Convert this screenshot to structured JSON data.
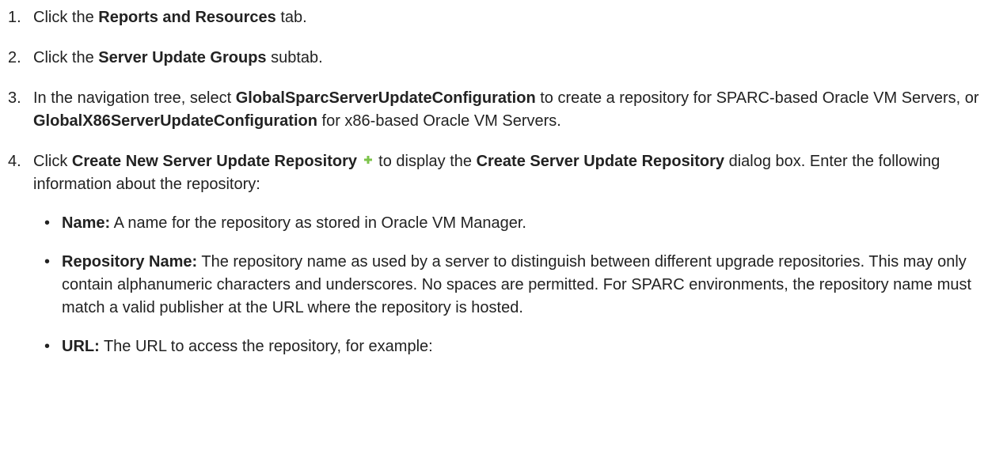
{
  "steps": [
    {
      "num": "1.",
      "t1": "Click the ",
      "b1": "Reports and Resources",
      "t2": " tab."
    },
    {
      "num": "2.",
      "t1": "Click the ",
      "b1": "Server Update Groups",
      "t2": " subtab."
    },
    {
      "num": "3.",
      "t1": "In the navigation tree, select ",
      "b1": "GlobalSparcServerUpdateConfiguration",
      "t2": " to create a repository for SPARC-based Oracle VM Servers, or ",
      "b2": "GlobalX86ServerUpdateConfiguration",
      "t3": " for x86-based Oracle VM Servers."
    },
    {
      "num": "4.",
      "t1": "Click ",
      "b1": "Create New Server Update Repository",
      "t2": " to display the ",
      "b2": "Create Server Update Repository",
      "t3": " dialog box. Enter the following information about the repository:",
      "icon": "plus-icon",
      "icon_color": "#7cc34a"
    }
  ],
  "bullets": [
    {
      "label": "Name:",
      "text": " A name for the repository as stored in Oracle VM Manager."
    },
    {
      "label": "Repository Name:",
      "text": " The repository name as used by a server to distinguish between different upgrade repositories. This may only contain alphanumeric characters and underscores. No spaces are permitted. For SPARC environments, the repository name must match a valid publisher at the URL where the repository is hosted."
    },
    {
      "label": "URL:",
      "text": " The URL to access the repository, for example:"
    }
  ]
}
